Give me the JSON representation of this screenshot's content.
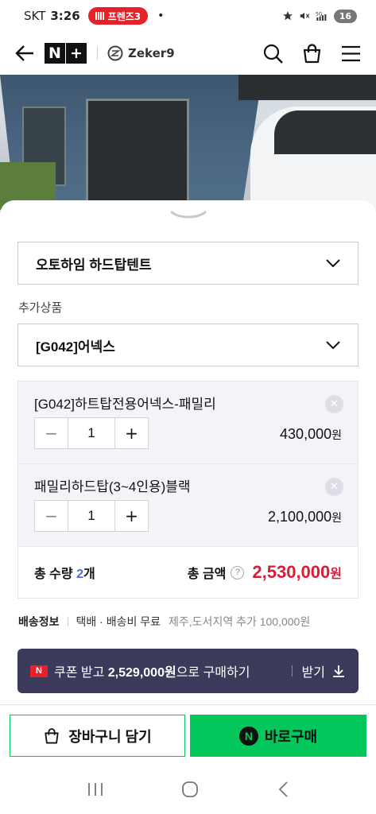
{
  "status_bar": {
    "carrier": "SKT",
    "time": "3:26",
    "call_pill": "프렌즈3",
    "dot": "•",
    "battery": "16"
  },
  "header": {
    "logo_n": "N",
    "logo_plus": "+",
    "brand": "Zeker9"
  },
  "options": {
    "main_select": "오토하임 하드탑텐트",
    "extra_label": "추가상품",
    "extra_select": "[G042]어넥스"
  },
  "items": [
    {
      "name": "[G042]하트탑전용어넥스-패밀리",
      "quantity": "1",
      "price": "430,000",
      "currency": "원"
    },
    {
      "name": "패밀리하드탑(3~4인용)블랙",
      "quantity": "1",
      "price": "2,100,000",
      "currency": "원"
    }
  ],
  "totals": {
    "qty_label": "총 수량",
    "qty_value": "2",
    "qty_unit": "개",
    "amount_label": "총 금액",
    "amount": "2,530,000",
    "currency": "원"
  },
  "shipping": {
    "title": "배송정보",
    "method": "택배 · 배송비 무료",
    "extra": "제주,도서지역 추가 100,000원"
  },
  "coupon": {
    "badge": "N",
    "text_prefix": "쿠폰 받고 ",
    "price": "2,529,000원",
    "text_suffix": "으로 구매하기",
    "receive": "받기"
  },
  "actions": {
    "cart": "장바구니 담기",
    "buy": "바로구매",
    "buy_badge": "N"
  },
  "colors": {
    "naver_green": "#03c75a",
    "price_red": "#d71e35",
    "coupon_bg": "#3c3a5a"
  }
}
